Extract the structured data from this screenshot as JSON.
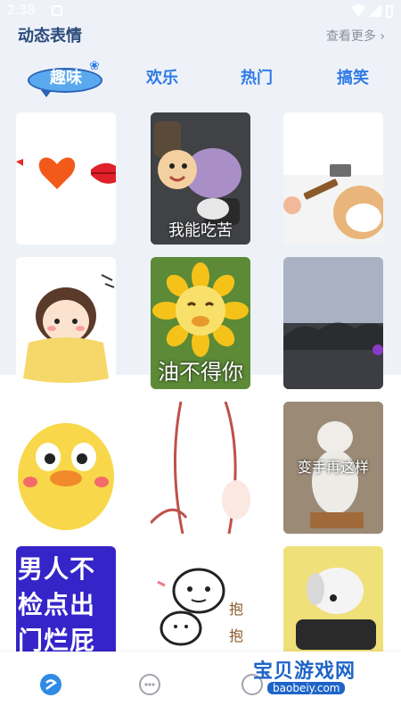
{
  "status_bar": {
    "time": "2:38"
  },
  "header": {
    "title": "动态表情",
    "more_label": "查看更多"
  },
  "tabs": [
    {
      "label": "趣味",
      "active": true
    },
    {
      "label": "欢乐",
      "active": false
    },
    {
      "label": "热门",
      "active": false
    },
    {
      "label": "搞笑",
      "active": false
    }
  ],
  "stickers": [
    {
      "name": "hearts-lips",
      "caption": ""
    },
    {
      "name": "dumbbell-character",
      "caption": "我能吃苦"
    },
    {
      "name": "dog-hammer",
      "caption": ""
    },
    {
      "name": "blanket-girl",
      "caption": ""
    },
    {
      "name": "sunflower",
      "caption": "油不得你"
    },
    {
      "name": "dark-rocks-night",
      "caption": ""
    },
    {
      "name": "yellow-chick",
      "caption": ""
    },
    {
      "name": "sketch-lines",
      "caption": ""
    },
    {
      "name": "cat-hands",
      "caption": "变手再这样"
    },
    {
      "name": "blue-text-banner",
      "caption": "男人不检点出门烂屁股"
    },
    {
      "name": "hug-doodle",
      "caption": "抱抱"
    },
    {
      "name": "puppy-sleeping",
      "caption": ""
    }
  ],
  "watermark": {
    "text": "宝贝游戏网",
    "url": "baobeiy.com"
  },
  "colors": {
    "accent": "#2f7ae5",
    "title": "#2b4a7a",
    "bubble": "#5aa9ef"
  }
}
